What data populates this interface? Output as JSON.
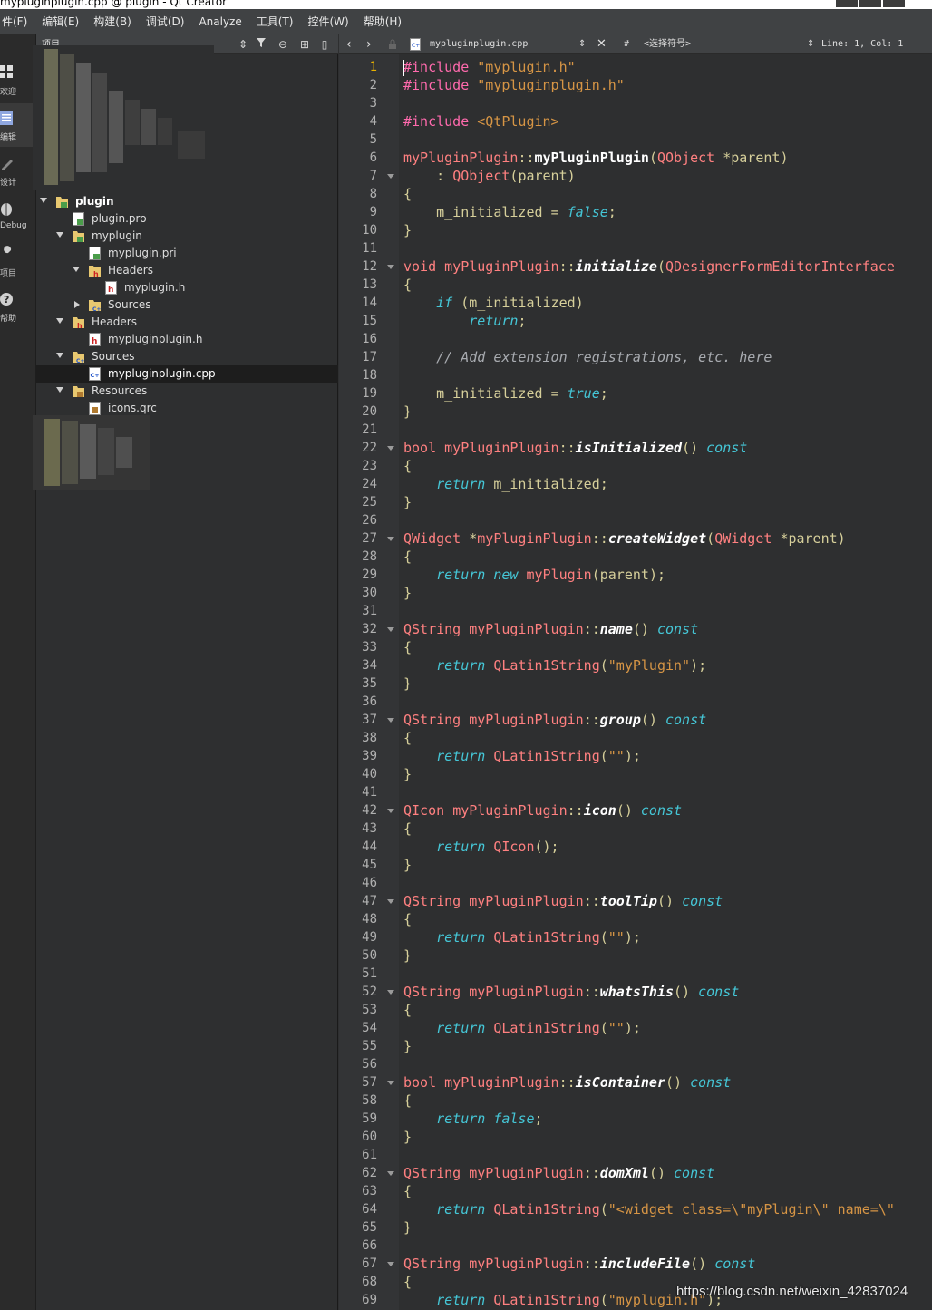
{
  "window": {
    "title": "mypluginplugin.cpp @ plugin - Qt Creator"
  },
  "menu": [
    "件(F)",
    "编辑(E)",
    "构建(B)",
    "调试(D)",
    "Analyze",
    "工具(T)",
    "控件(W)",
    "帮助(H)"
  ],
  "modes": [
    {
      "label": "欢迎",
      "icon": "grid-icon"
    },
    {
      "label": "编辑",
      "icon": "document-icon"
    },
    {
      "label": "设计",
      "icon": "pencil-icon"
    },
    {
      "label": "Debug",
      "icon": "bug-icon"
    },
    {
      "label": "项目",
      "icon": "wrench-icon"
    },
    {
      "label": "帮助",
      "icon": "help-icon"
    }
  ],
  "project": {
    "title": "项目",
    "tree": [
      {
        "label": "plugin",
        "icon": "project-folder-icon",
        "expanded": true,
        "bold": true
      },
      {
        "label": "plugin.pro",
        "icon": "pro-file-icon"
      },
      {
        "label": "myplugin",
        "icon": "project-folder-icon",
        "expanded": true
      },
      {
        "label": "myplugin.pri",
        "icon": "pro-file-icon"
      },
      {
        "label": "Headers",
        "icon": "header-folder-icon",
        "expanded": true
      },
      {
        "label": "myplugin.h",
        "icon": "header-file-icon"
      },
      {
        "label": "Sources",
        "icon": "source-folder-icon",
        "expanded": false
      },
      {
        "label": "Headers",
        "icon": "header-folder-icon",
        "expanded": true
      },
      {
        "label": "mypluginplugin.h",
        "icon": "header-file-icon"
      },
      {
        "label": "Sources",
        "icon": "source-folder-icon",
        "expanded": true
      },
      {
        "label": "mypluginplugin.cpp",
        "icon": "cpp-file-icon",
        "selected": true
      },
      {
        "label": "Resources",
        "icon": "resource-folder-icon",
        "expanded": true
      },
      {
        "label": "icons.qrc",
        "icon": "qrc-file-icon"
      }
    ]
  },
  "editor": {
    "file_name": "mypluginplugin.cpp",
    "symbol_hash": "#",
    "symbol_placeholder": "<选择符号>",
    "position": "Line: 1, Col: 1",
    "current_line": 1
  },
  "code_lines": [
    "#include \"myplugin.h\"",
    "#include \"mypluginplugin.h\"",
    "",
    "#include <QtPlugin>",
    "",
    "myPluginPlugin::myPluginPlugin(QObject *parent)",
    "    : QObject(parent)",
    "{",
    "    m_initialized = false;",
    "}",
    "",
    "void myPluginPlugin::initialize(QDesignerFormEditorInterface",
    "{",
    "    if (m_initialized)",
    "        return;",
    "",
    "    // Add extension registrations, etc. here",
    "",
    "    m_initialized = true;",
    "}",
    "",
    "bool myPluginPlugin::isInitialized() const",
    "{",
    "    return m_initialized;",
    "}",
    "",
    "QWidget *myPluginPlugin::createWidget(QWidget *parent)",
    "{",
    "    return new myPlugin(parent);",
    "}",
    "",
    "QString myPluginPlugin::name() const",
    "{",
    "    return QLatin1String(\"myPlugin\");",
    "}",
    "",
    "QString myPluginPlugin::group() const",
    "{",
    "    return QLatin1String(\"\");",
    "}",
    "",
    "QIcon myPluginPlugin::icon() const",
    "{",
    "    return QIcon();",
    "}",
    "",
    "QString myPluginPlugin::toolTip() const",
    "{",
    "    return QLatin1String(\"\");",
    "}",
    "",
    "QString myPluginPlugin::whatsThis() const",
    "{",
    "    return QLatin1String(\"\");",
    "}",
    "",
    "bool myPluginPlugin::isContainer() const",
    "{",
    "    return false;",
    "}",
    "",
    "QString myPluginPlugin::domXml() const",
    "{",
    "    return QLatin1String(\"<widget class=\\\"myPlugin\\\" name=\\\"",
    "}",
    "",
    "QString myPluginPlugin::includeFile() const",
    "{",
    "    return QLatin1String(\"myplugin.h\");"
  ],
  "fold_lines": [
    7,
    12,
    22,
    27,
    32,
    37,
    42,
    47,
    52,
    57,
    62,
    67
  ],
  "watermark": "https://blog.csdn.net/weixin_42837024",
  "colors": {
    "preprocessor": "#ff6aad",
    "string": "#d69545",
    "keyword": "#45c6d6",
    "type": "#ff8080",
    "comment": "#a8abb0",
    "identifier": "#d6cf9a"
  }
}
